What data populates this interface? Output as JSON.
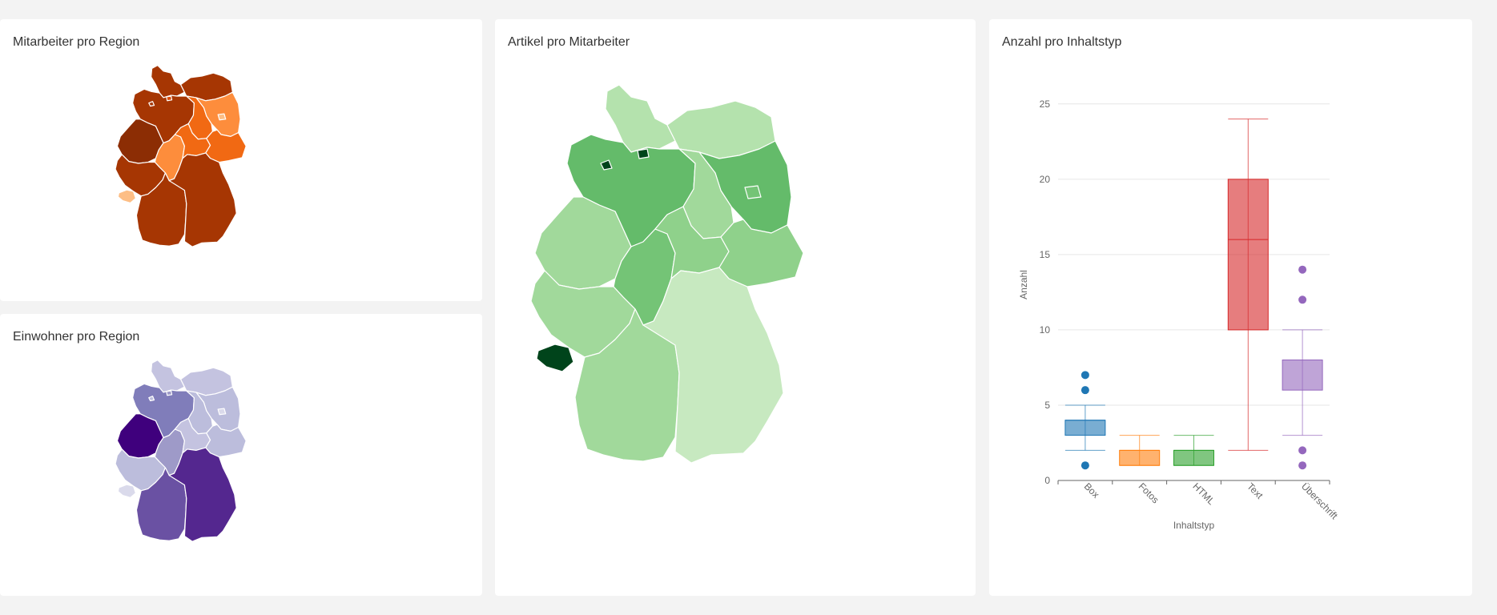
{
  "panels": {
    "employees": {
      "title": "Mitarbeiter pro Region"
    },
    "residents": {
      "title": "Einwohner pro Region"
    },
    "articles": {
      "title": "Artikel pro Mitarbeiter"
    },
    "content_types": {
      "title": "Anzahl pro Inhaltstyp"
    }
  },
  "colors": {
    "oranges": [
      "#fdbe85",
      "#fd8d3c",
      "#f16913",
      "#d94801",
      "#a63603",
      "#8c2d04",
      "#7f2704"
    ],
    "purples": [
      "#dadaeb",
      "#c4c3e0",
      "#bcbddc",
      "#9e9ac8",
      "#8c86c1",
      "#807dba",
      "#6a51a3",
      "#54278f",
      "#3f007d"
    ],
    "greens": [
      "#c7e9c0",
      "#b4e2ad",
      "#a1d99b",
      "#8fd18b",
      "#74c476",
      "#64bb6a",
      "#41ab5d",
      "#00441b"
    ]
  },
  "chart_data": {
    "type": "box",
    "xlabel": "Inhaltstyp",
    "ylabel": "Anzahl",
    "ylim": [
      0,
      26
    ],
    "yticks": [
      "0",
      "5",
      "10",
      "15",
      "20",
      "25"
    ],
    "series": [
      {
        "category": "Box",
        "min": 2,
        "q1": 3,
        "median": 4,
        "q3": 4,
        "max": 5,
        "outliers": [
          1,
          6,
          7
        ],
        "color": "#1f77b4"
      },
      {
        "category": "Fotos",
        "min": 1,
        "q1": 1,
        "median": 2,
        "q3": 2,
        "max": 3,
        "outliers": [],
        "color": "#ff7f0e"
      },
      {
        "category": "HTML",
        "min": 1,
        "q1": 1,
        "median": 2,
        "q3": 2,
        "max": 3,
        "outliers": [],
        "color": "#2ca02c"
      },
      {
        "category": "Text",
        "min": 2,
        "q1": 10,
        "median": 16,
        "q3": 20,
        "max": 24,
        "outliers": [],
        "color": "#d62728"
      },
      {
        "category": "Überschrift",
        "min": 3,
        "q1": 6,
        "median": 8,
        "q3": 8,
        "max": 10,
        "outliers": [
          1,
          2,
          12,
          14
        ],
        "color": "#9467bd"
      }
    ]
  }
}
